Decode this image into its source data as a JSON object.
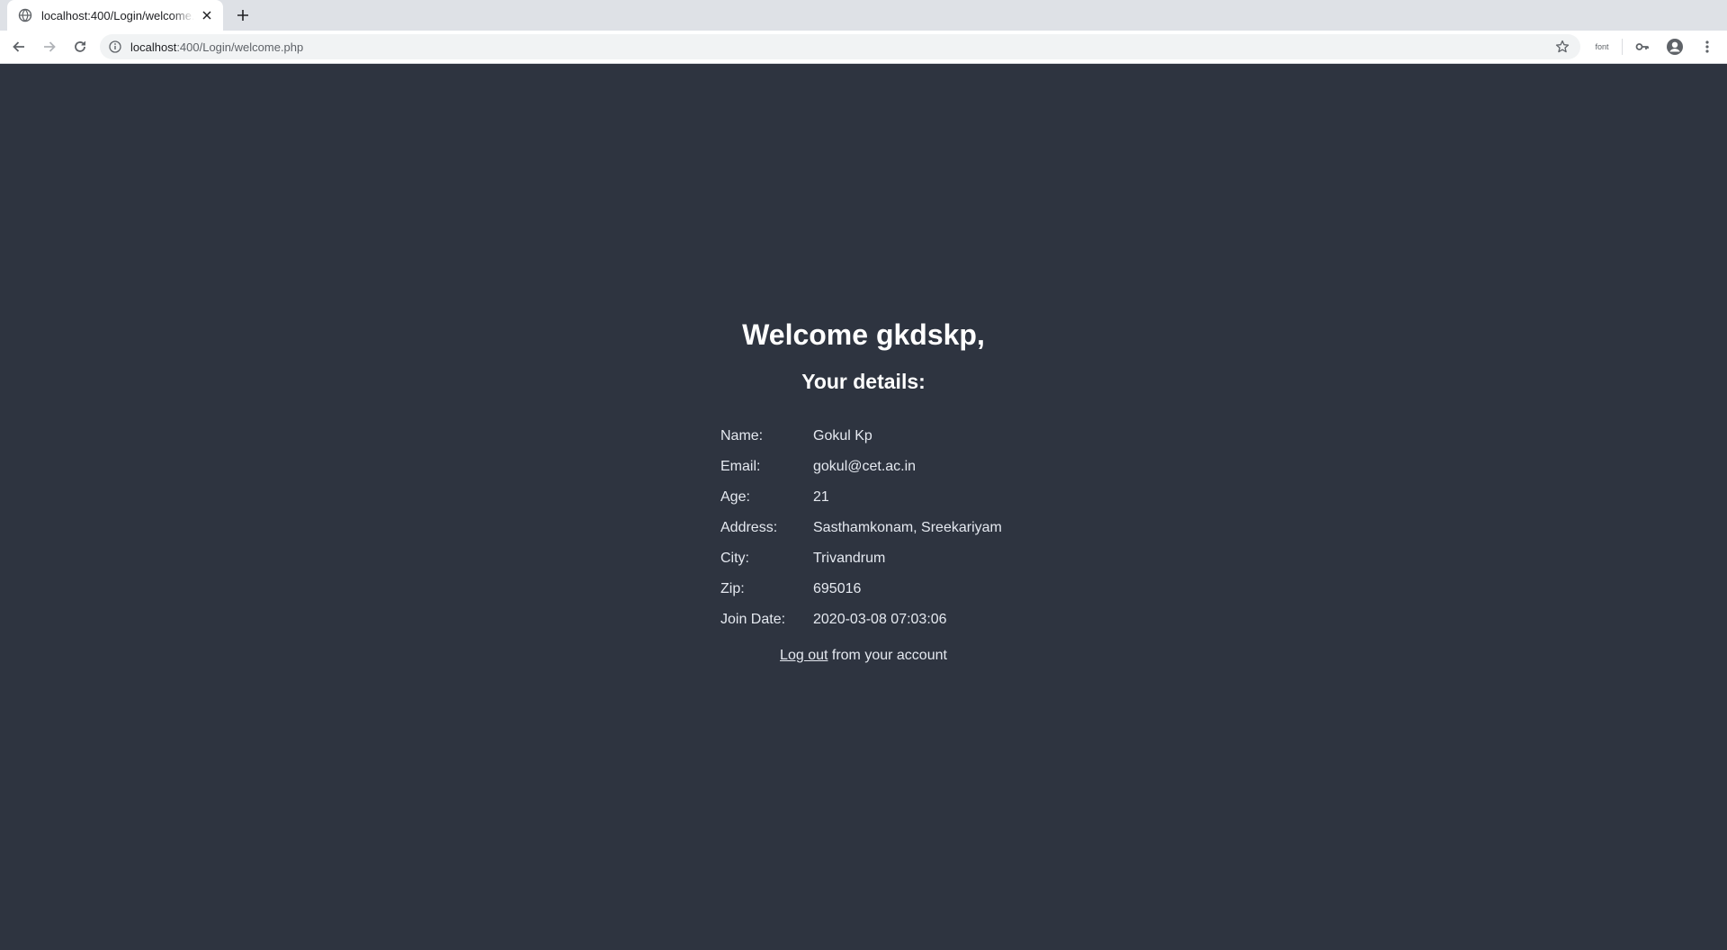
{
  "browser": {
    "tab": {
      "title": "localhost:400/Login/welcome.php"
    },
    "address_bar": {
      "host": "localhost",
      "path": ":400/Login/welcome.php"
    },
    "extension_label": "font"
  },
  "page": {
    "welcome": "Welcome gkdskp,",
    "subheading": "Your details:",
    "details": [
      {
        "label": "Name:",
        "value": "Gokul Kp"
      },
      {
        "label": "Email:",
        "value": "gokul@cet.ac.in"
      },
      {
        "label": "Age:",
        "value": "21"
      },
      {
        "label": "Address:",
        "value": "Sasthamkonam, Sreekariyam"
      },
      {
        "label": "City:",
        "value": "Trivandrum"
      },
      {
        "label": "Zip:",
        "value": "695016"
      },
      {
        "label": "Join Date:",
        "value": "2020-03-08 07:03:06"
      }
    ],
    "logout_link": "Log out",
    "logout_suffix": " from your account"
  },
  "colors": {
    "page_background": "#2e3440",
    "text": "#ffffff"
  }
}
